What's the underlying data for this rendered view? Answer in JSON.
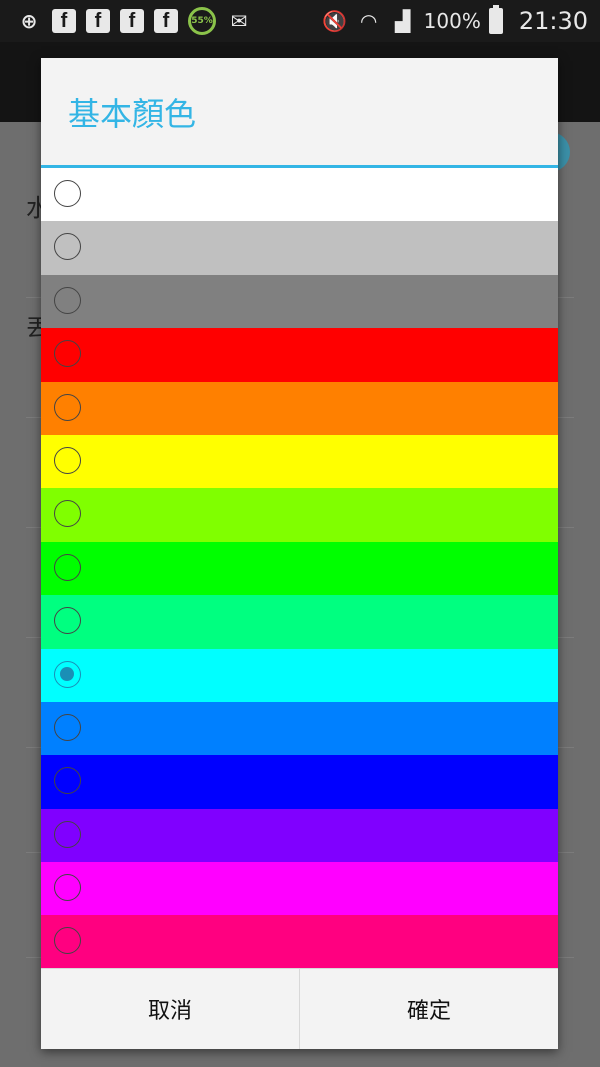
{
  "status_bar": {
    "battery_ring": "55%",
    "battery_percent": "100%",
    "time": "21:30",
    "icons": [
      "back-plus-icon",
      "facebook-icon",
      "facebook-icon",
      "facebook-icon",
      "facebook-icon",
      "battery-ring-icon",
      "messenger-icon",
      "mute-icon",
      "wifi-icon",
      "signal-icon",
      "battery-icon"
    ]
  },
  "background": {
    "label_1": "水",
    "label_2": "丟"
  },
  "dialog": {
    "title": "基本顏色",
    "colors": [
      "#ffffff",
      "#c0c0c0",
      "#808080",
      "#ff0000",
      "#ff8000",
      "#ffff00",
      "#80ff00",
      "#00ff00",
      "#00ff80",
      "#00ffff",
      "#0080ff",
      "#0000ff",
      "#8000ff",
      "#ff00ff",
      "#ff0080"
    ],
    "selected_index": 9,
    "cancel_label": "取消",
    "ok_label": "確定"
  }
}
